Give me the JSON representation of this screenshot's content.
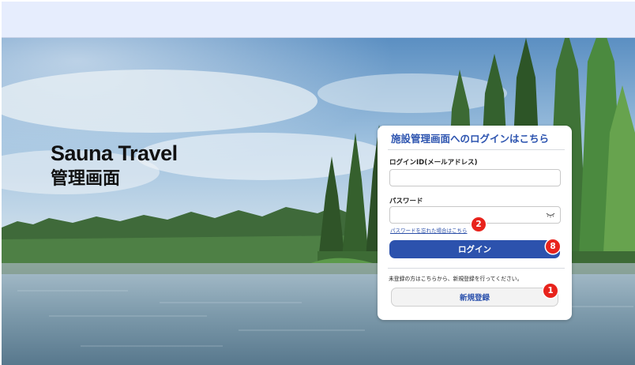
{
  "brand": {
    "name": "Sauna Travel",
    "subtitle": "管理画面"
  },
  "login_card": {
    "title": "施設管理画面へのログインはこちら",
    "login_id_label": "ログインID(メールアドレス)",
    "login_id_value": "",
    "password_label": "パスワード",
    "password_value": "",
    "forgot_password_link": "パスワードを忘れた場合はこちら",
    "login_button": "ログイン",
    "register_note": "未登録の方はこちらから、新規登録を行ってください。",
    "register_button": "新規登録"
  },
  "badges": {
    "forgot": "2",
    "login": "8",
    "register": "1"
  },
  "colors": {
    "header_bg": "#e6edfd",
    "accent": "#2c52ad",
    "badge": "#e8231c"
  },
  "icons": {
    "password_visibility": "eye-closed-icon"
  }
}
